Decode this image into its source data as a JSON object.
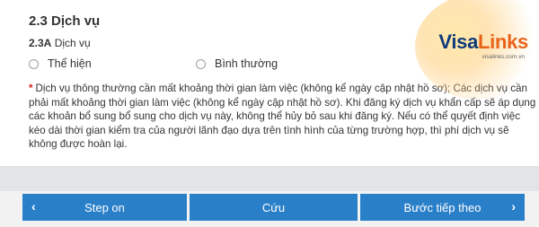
{
  "section": {
    "title": "2.3 Dịch vụ",
    "sub_code": "2.3A",
    "sub_label": "Dịch vụ"
  },
  "options": [
    {
      "label": "Thể hiện",
      "selected": false
    },
    {
      "label": "Bình thường",
      "selected": false
    }
  ],
  "note": {
    "marker": "*",
    "text": "Dịch vụ thông thường cần mất khoảng thời gian làm việc (không kể ngày cập nhật hồ sơ); Các dịch vụ cần phải mất khoảng thời gian làm việc (không kể ngày cập nhật hồ sơ). Khi đăng ký dịch vụ khẩn cấp sẽ áp dụng các khoản bổ sung bổ sung cho dịch vụ này, không thể hủy bỏ sau khi đăng ký. Nếu có thể quyết định việc kéo dài thời gian kiểm tra của người lãnh đạo dựa trên tình hình của từng trường hợp, thì phí dịch vụ sẽ không được hoàn lại."
  },
  "logo": {
    "brand_a": "Visa",
    "brand_b": "Links",
    "url": "visalinks.com.vn",
    "colors": {
      "visa": "#0f3a78",
      "links": "#e8641b"
    }
  },
  "buttons": {
    "prev_label": "Step on",
    "save_label": "Cứu",
    "next_label": "Bước tiếp theo",
    "color": "#2a7fc9"
  }
}
